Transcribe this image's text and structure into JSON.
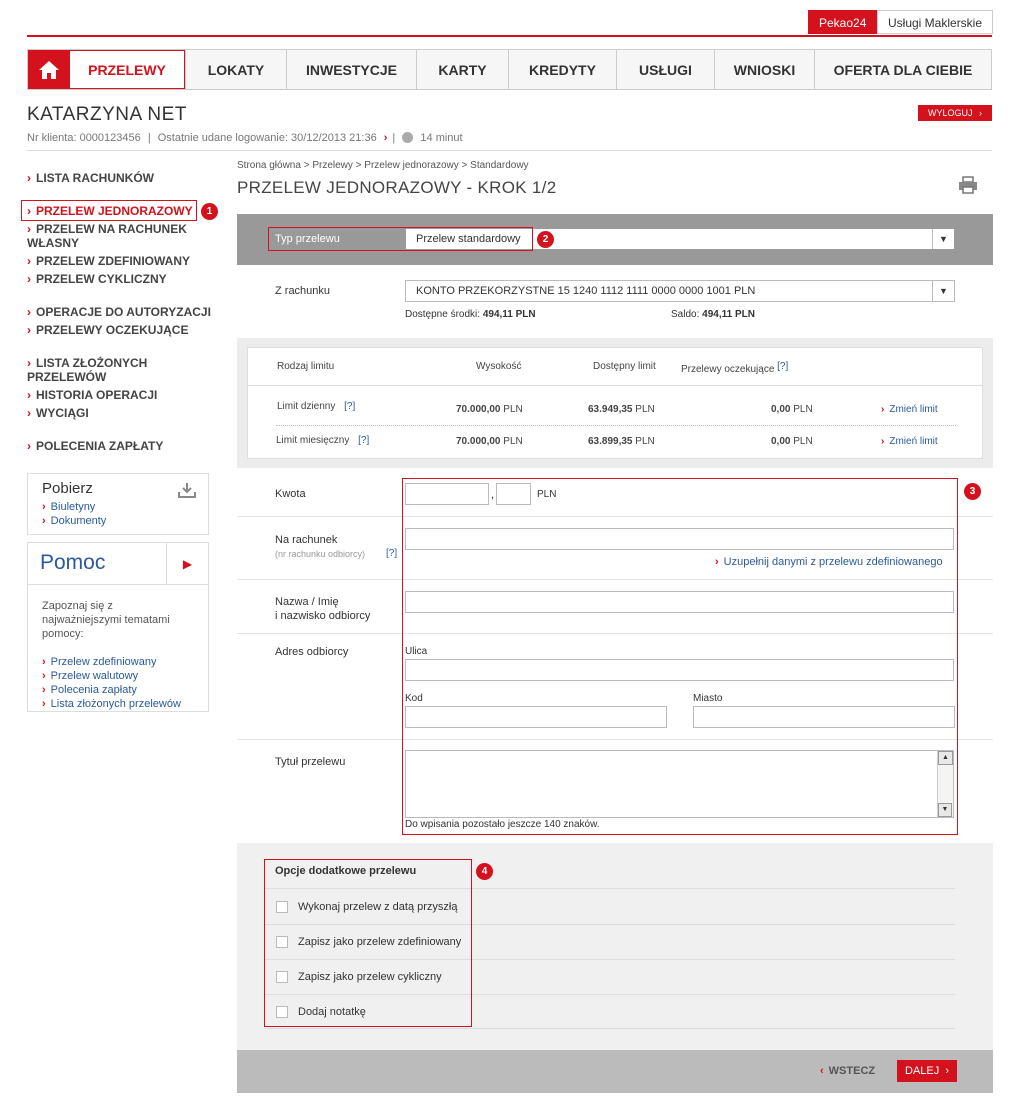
{
  "top_tabs": [
    {
      "label": "Pekao24",
      "active": true
    },
    {
      "label": "Usługi Maklerskie",
      "active": false
    }
  ],
  "nav": {
    "items": [
      "PRZELEWY",
      "LOKATY",
      "INWESTYCJE",
      "KARTY",
      "KREDYTY",
      "USŁUGI",
      "WNIOSKI",
      "OFERTA DLA CIEBIE"
    ],
    "active_index": 0
  },
  "user": {
    "name": "KATARZYNA NET",
    "client_label": "Nr klienta: 0000123456",
    "last_login": "Ostatnie udane logowanie: 30/12/2013 21:36",
    "session": "14 minut",
    "logout": "WYLOGUJ"
  },
  "sidebar": {
    "items": [
      {
        "label": "LISTA RACHUNKÓW"
      },
      {
        "label": "PRZELEW JEDNORAZOWY",
        "active": true
      },
      {
        "label": "PRZELEW NA RACHUNEK WŁASNY"
      },
      {
        "label": "PRZELEW ZDEFINIOWANY"
      },
      {
        "label": "PRZELEW CYKLICZNY"
      },
      {
        "label": "OPERACJE DO AUTORYZACJI"
      },
      {
        "label": "PRZELEWY OCZEKUJĄCE"
      },
      {
        "label": "LISTA ZŁOŻONYCH PRZELEWÓW"
      },
      {
        "label": "HISTORIA OPERACJI"
      },
      {
        "label": "WYCIĄGI"
      },
      {
        "label": "POLECENIA ZAPŁATY"
      }
    ],
    "pobierz": {
      "title": "Pobierz",
      "links": [
        "Biuletyny",
        "Dokumenty"
      ]
    },
    "pomoc": {
      "title": "Pomoc",
      "text": "Zapoznaj się z najważniejszymi tematami pomocy:",
      "links": [
        "Przelew zdefiniowany",
        "Przelew walutowy",
        "Polecenia zapłaty",
        "Lista złożonych przelewów"
      ]
    }
  },
  "page": {
    "breadcrumb": "Strona główna > Przelewy > Przelew jednorazowy > Standardowy",
    "title": "PRZELEW JEDNORAZOWY - KROK 1/2"
  },
  "markers": [
    "1",
    "2",
    "3",
    "4"
  ],
  "typ": {
    "label": "Typ przelewu",
    "value": "Przelew standardowy"
  },
  "account": {
    "label": "Z rachunku",
    "value": "KONTO PRZEKORZYSTNE 15 1240 1112 1111 0000 0000 1001 PLN",
    "available_label": "Dostępne środki:",
    "available": "494,11 PLN",
    "balance_label": "Saldo:",
    "balance": "494,11 PLN"
  },
  "limits": {
    "headers": [
      "Rodzaj limitu",
      "Wysokość",
      "Dostępny limit",
      "Przelewy oczekujące"
    ],
    "help": "[?]",
    "currency": "PLN",
    "change_label": "Zmień limit",
    "rows": [
      {
        "name": "Limit dzienny",
        "amount": "70.000,00",
        "available": "63.949,35",
        "pending": "0,00"
      },
      {
        "name": "Limit miesięczny",
        "amount": "70.000,00",
        "available": "63.899,35",
        "pending": "0,00"
      }
    ]
  },
  "form": {
    "amount_label": "Kwota",
    "amount_sep": ",",
    "currency": "PLN",
    "account_label": "Na rachunek",
    "account_sub": "(nr rachunku odbiorcy)",
    "help": "[?]",
    "fill_link": "Uzupełnij danymi z przelewu zdefiniowanego",
    "name_label_1": "Nazwa / Imię",
    "name_label_2": "i nazwisko odbiorcy",
    "address_label": "Adres odbiorcy",
    "street_label": "Ulica",
    "zip_label": "Kod",
    "city_label": "Miasto",
    "title_label": "Tytuł przelewu",
    "remaining": "Do wpisania pozostało jeszcze 140 znaków."
  },
  "options": {
    "title": "Opcje dodatkowe przelewu",
    "items": [
      "Wykonaj przelew z datą przyszłą",
      "Zapisz jako przelew zdefiniowany",
      "Zapisz jako przelew cykliczny",
      "Dodaj notatkę"
    ]
  },
  "footer": {
    "back": "WSTECZ",
    "next": "DALEJ"
  }
}
